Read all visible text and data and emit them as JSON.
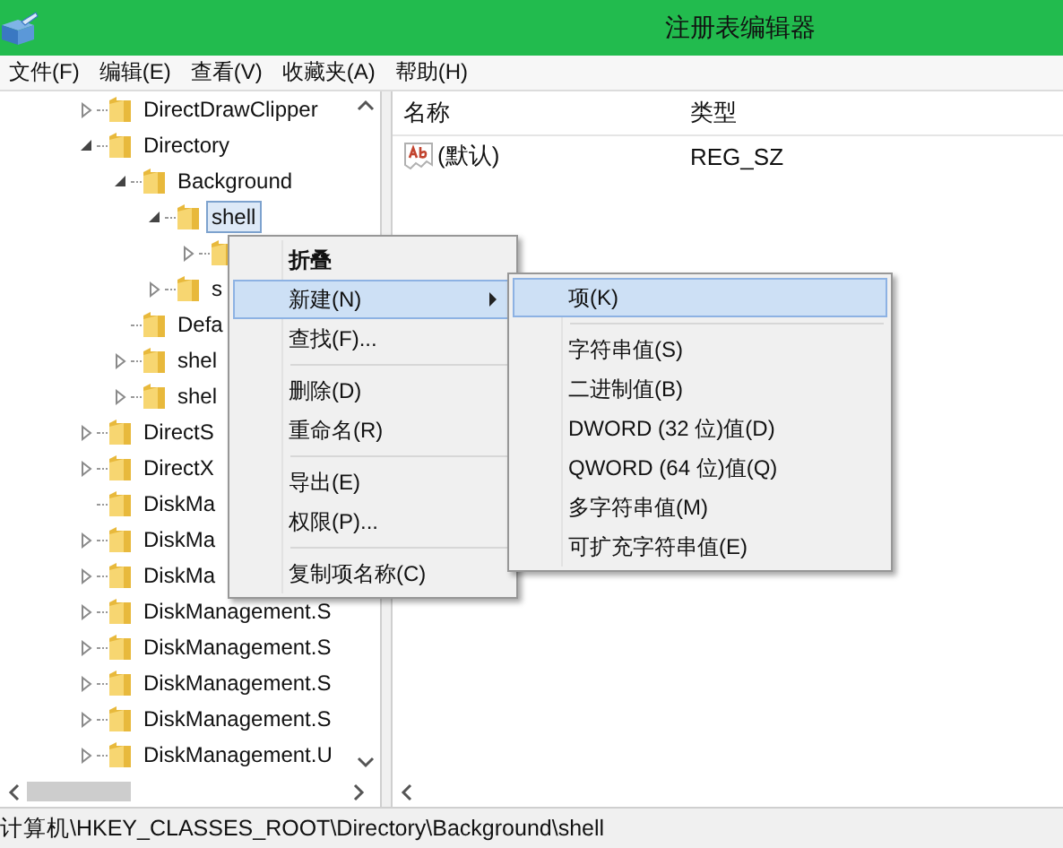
{
  "window": {
    "title": "注册表编辑器"
  },
  "menu_bar": [
    "文件(F)",
    "编辑(E)",
    "查看(V)",
    "收藏夹(A)",
    "帮助(H)"
  ],
  "tree": [
    {
      "label": "DirectDrawClipper",
      "expanded": false,
      "selected": false
    },
    {
      "label": "Directory",
      "expanded": true,
      "selected": false,
      "children": [
        {
          "label": "Background",
          "expanded": true,
          "selected": false,
          "children": [
            {
              "label": "shell",
              "expanded": true,
              "selected": true,
              "children": [
                {
                  "expanded": false,
                  "selected": false
                }
              ]
            },
            {
              "label": "s",
              "expanded": false,
              "selected": false
            }
          ]
        },
        {
          "label": "Defa",
          "selected": false
        },
        {
          "label": "shel",
          "expanded": false,
          "selected": false
        },
        {
          "label": "shel",
          "expanded": false,
          "selected": false
        }
      ]
    },
    {
      "label": "DirectS",
      "expanded": false,
      "selected": false
    },
    {
      "label": "DirectX",
      "expanded": false,
      "selected": false
    },
    {
      "label": "DiskMa",
      "selected": false
    },
    {
      "label": "DiskMa",
      "expanded": false,
      "selected": false
    },
    {
      "label": "DiskMa",
      "expanded": false,
      "selected": false
    },
    {
      "label": "DiskManagement.S",
      "expanded": false,
      "selected": false
    },
    {
      "label": "DiskManagement.S",
      "expanded": false,
      "selected": false
    },
    {
      "label": "DiskManagement.S",
      "expanded": false,
      "selected": false
    },
    {
      "label": "DiskManagement.S",
      "expanded": false,
      "selected": false
    },
    {
      "label": "DiskManagement.U",
      "expanded": false,
      "selected": false
    }
  ],
  "values": {
    "columns": [
      "名称",
      "类型"
    ],
    "rows": [
      {
        "name": "(默认)",
        "type": "REG_SZ"
      }
    ]
  },
  "context_menu": [
    {
      "kind": "item",
      "label": "折叠",
      "bold": true,
      "selected": false,
      "submenu": false
    },
    {
      "kind": "item",
      "label": "新建(N)",
      "bold": false,
      "selected": true,
      "submenu": true
    },
    {
      "kind": "item",
      "label": "查找(F)...",
      "bold": false,
      "selected": false,
      "submenu": false
    },
    {
      "kind": "separator"
    },
    {
      "kind": "item",
      "label": "删除(D)",
      "bold": false,
      "selected": false,
      "submenu": false
    },
    {
      "kind": "item",
      "label": "重命名(R)",
      "bold": false,
      "selected": false,
      "submenu": false
    },
    {
      "kind": "separator"
    },
    {
      "kind": "item",
      "label": "导出(E)",
      "bold": false,
      "selected": false,
      "submenu": false
    },
    {
      "kind": "item",
      "label": "权限(P)...",
      "bold": false,
      "selected": false,
      "submenu": false
    },
    {
      "kind": "separator"
    },
    {
      "kind": "item",
      "label": "复制项名称(C)",
      "bold": false,
      "selected": false,
      "submenu": false
    }
  ],
  "submenu": [
    {
      "kind": "item",
      "label": "项(K)",
      "selected": true
    },
    {
      "kind": "separator"
    },
    {
      "kind": "item",
      "label": "字符串值(S)",
      "selected": false
    },
    {
      "kind": "item",
      "label": "二进制值(B)",
      "selected": false
    },
    {
      "kind": "item",
      "label": "DWORD (32 位)值(D)",
      "selected": false
    },
    {
      "kind": "item",
      "label": "QWORD (64 位)值(Q)",
      "selected": false
    },
    {
      "kind": "item",
      "label": "多字符串值(M)",
      "selected": false
    },
    {
      "kind": "item",
      "label": "可扩充字符串值(E)",
      "selected": false
    }
  ],
  "status_bar": "计算机\\HKEY_CLASSES_ROOT\\Directory\\Background\\shell"
}
